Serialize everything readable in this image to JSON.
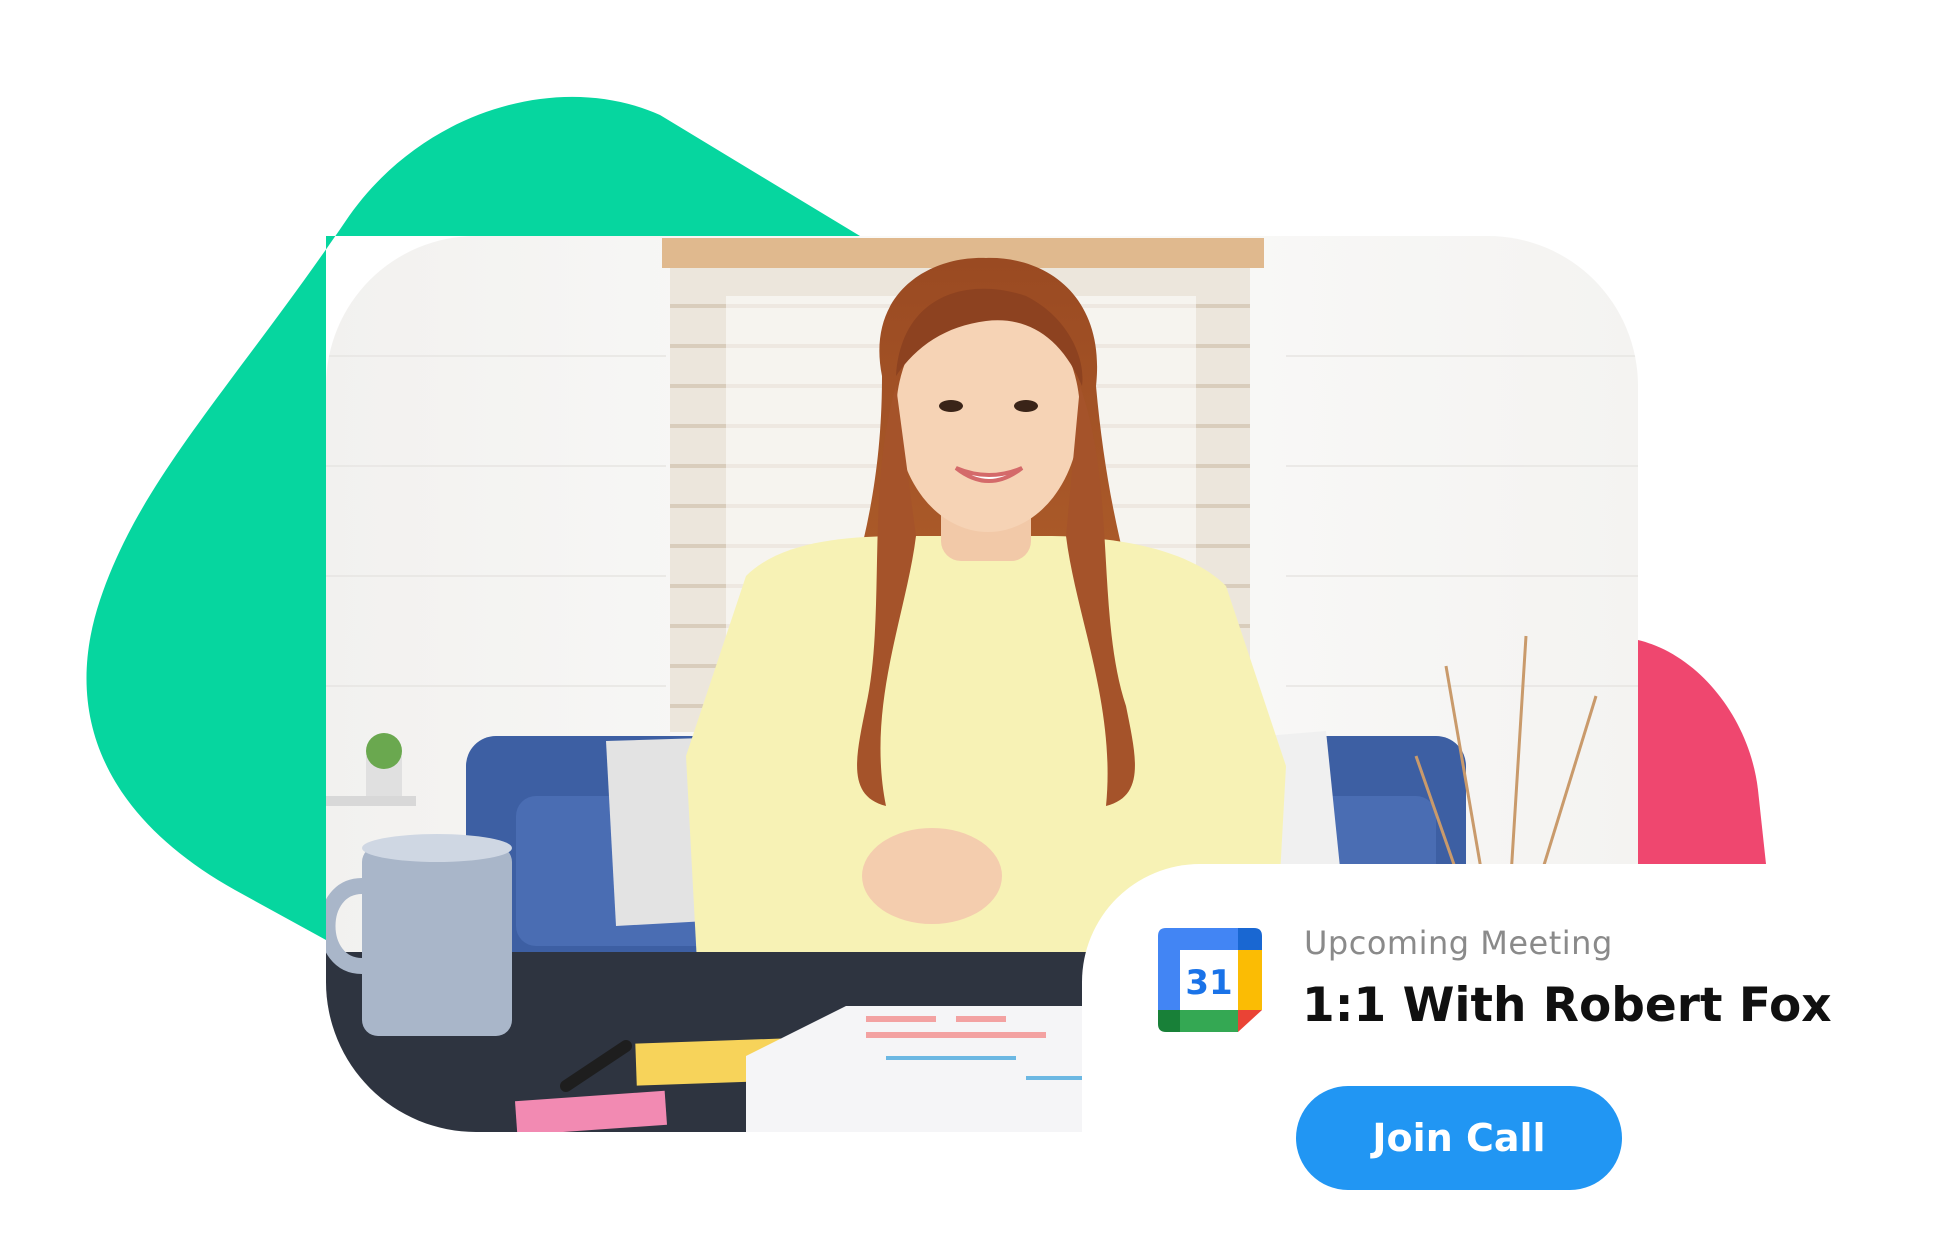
{
  "colors": {
    "green_blob": "#06d69f",
    "pink_blob": "#ef476f",
    "button": "#2196f3",
    "label": "#8a8a8a",
    "title": "#101010"
  },
  "photo": {
    "icon": "person-video-call-photo"
  },
  "meeting_card": {
    "icon": "google-calendar-icon",
    "calendar_day": "31",
    "label": "Upcoming Meeting",
    "title": "1:1 With Robert Fox",
    "join_label": "Join Call"
  }
}
